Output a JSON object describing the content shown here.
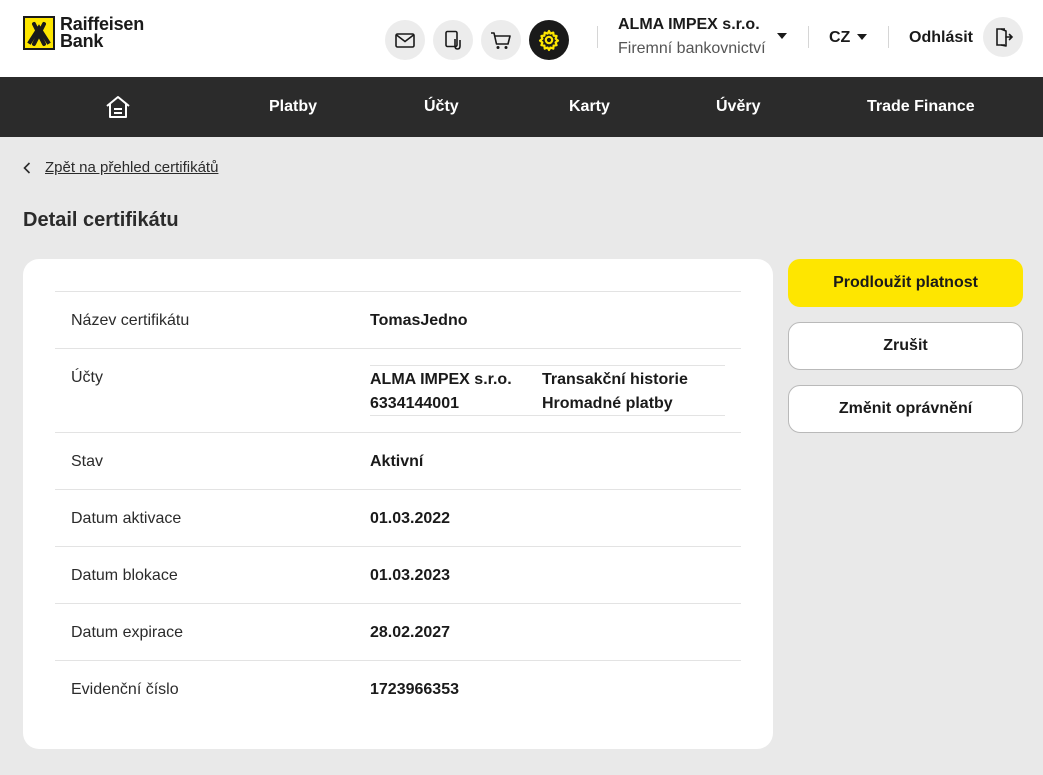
{
  "brand": {
    "line1": "Raiffeisen",
    "line2": "Bank"
  },
  "header": {
    "icons": [
      "mail-icon",
      "documents-icon",
      "cart-icon",
      "settings-icon"
    ],
    "company_name": "ALMA IMPEX s.r.o.",
    "company_sub": "Firemní bankovnictví",
    "language": "CZ",
    "logout_label": "Odhlásit"
  },
  "nav": {
    "items": [
      "Platby",
      "Účty",
      "Karty",
      "Úvěry",
      "Trade Finance"
    ]
  },
  "back_link": "Zpět na přehled certifikátů",
  "page_title": "Detail certifikátu",
  "details": {
    "name": {
      "label": "Název certifikátu",
      "value": "TomasJedno"
    },
    "accounts": {
      "label": "Účty",
      "company": "ALMA IMPEX s.r.o.",
      "number": "6334144001",
      "perm1": "Transakční historie",
      "perm2": "Hromadné platby"
    },
    "status": {
      "label": "Stav",
      "value": "Aktivní"
    },
    "activation": {
      "label": "Datum aktivace",
      "value": "01.03.2022"
    },
    "blocking": {
      "label": "Datum blokace",
      "value": "01.03.2023"
    },
    "expiration": {
      "label": "Datum expirace",
      "value": "28.02.2027"
    },
    "evidence": {
      "label": "Evidenční číslo",
      "value": "1723966353"
    }
  },
  "actions": {
    "extend": "Prodloužit platnost",
    "cancel": "Zrušit",
    "change_permissions": "Změnit oprávnění"
  },
  "colors": {
    "brand_yellow": "#fee600",
    "nav_bg": "#2b2b2b",
    "page_bg": "#e9e9e9"
  }
}
